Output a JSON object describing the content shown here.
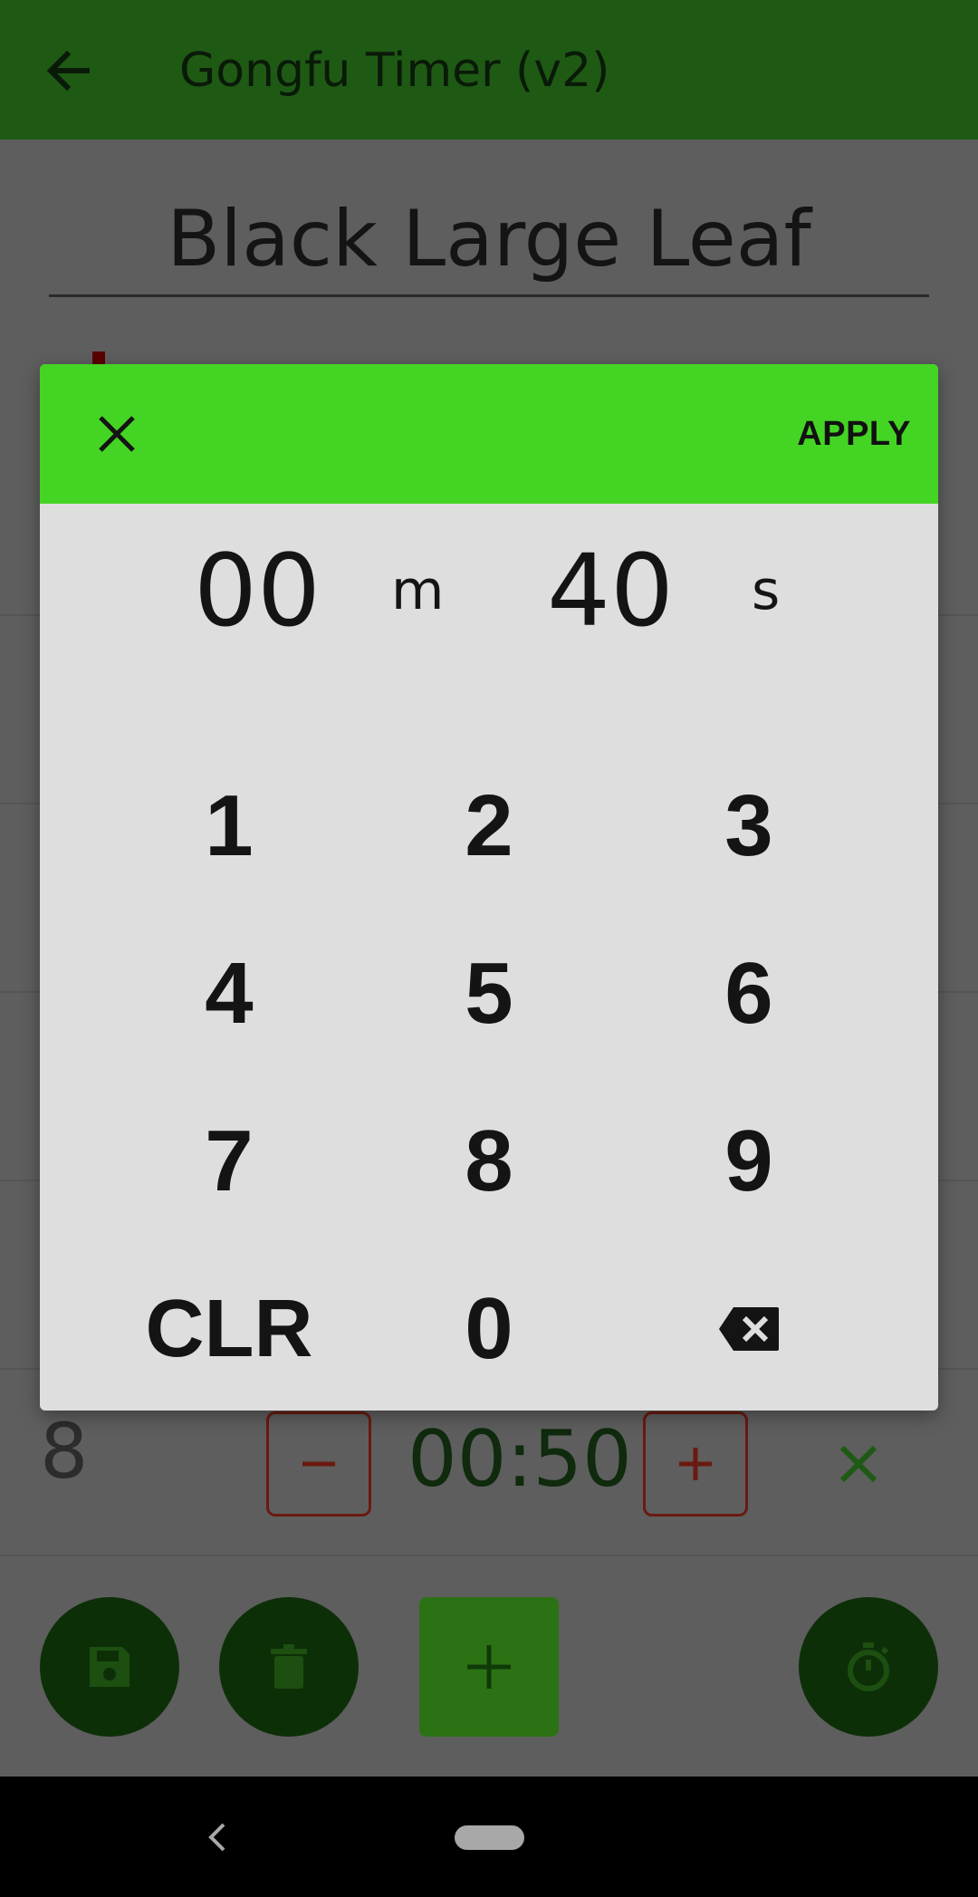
{
  "app": {
    "title": "Gongfu Timer (v2)"
  },
  "tea": {
    "name": "Black Large Leaf"
  },
  "steep": {
    "number": "8",
    "time": "00:50"
  },
  "dialog": {
    "apply_label": "APPLY",
    "minutes": "00",
    "minutes_unit": "m",
    "seconds": "40",
    "seconds_unit": "s",
    "keys": [
      "1",
      "2",
      "3",
      "4",
      "5",
      "6",
      "7",
      "8",
      "9",
      "CLR",
      "0"
    ]
  },
  "colors": {
    "appbar": "#1e5a14",
    "dialog_header": "#44d424",
    "dialog_body": "#dedede",
    "scrim_page": "#5e5e5e",
    "stepper_border": "#6a1a10"
  },
  "icons": {
    "back": "arrow-left-icon",
    "close": "close-icon",
    "backspace": "backspace-icon",
    "save": "save-icon",
    "delete": "trash-icon",
    "add": "plus-icon",
    "timer": "stopwatch-icon"
  }
}
